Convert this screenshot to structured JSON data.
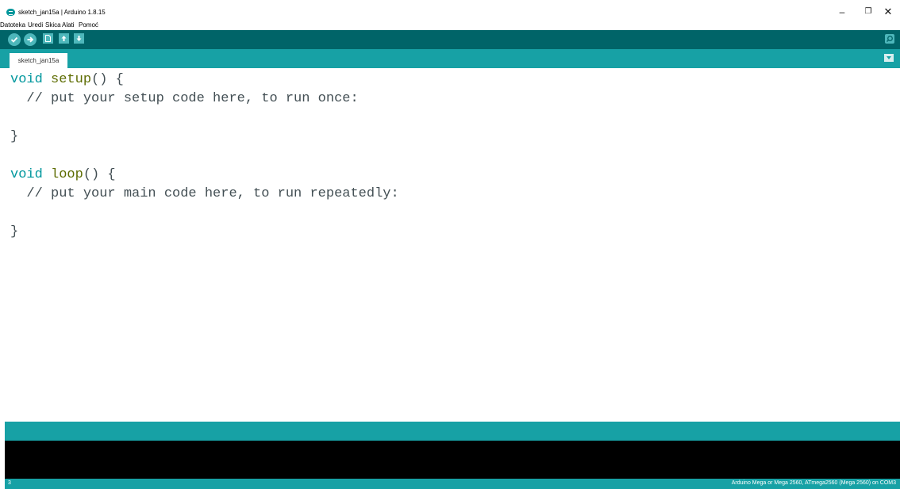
{
  "window": {
    "title": "sketch_jan15a | Arduino 1.8.15",
    "minimize": "–",
    "restore": "❐",
    "close": "✕"
  },
  "menu": [
    "Datoteka",
    "Uredi",
    "Skica",
    "Alati",
    "Pomoć"
  ],
  "toolbar": {
    "icons": [
      "verify-icon",
      "upload-icon",
      "new-icon",
      "open-icon",
      "save-icon",
      "serial-monitor-icon"
    ]
  },
  "tabs": [
    {
      "label": "sketch_jan15a"
    }
  ],
  "editor": {
    "lines": [
      {
        "type": "void",
        "name": "setup",
        "rest": "() {"
      },
      {
        "comment": "  // put your setup code here, to run once:"
      },
      {
        "text": ""
      },
      {
        "text": "}"
      },
      {
        "text": ""
      },
      {
        "type": "void",
        "name": "loop",
        "rest": "() {"
      },
      {
        "comment": "  // put your main code here, to run repeatedly:"
      },
      {
        "text": ""
      },
      {
        "text": "}"
      }
    ]
  },
  "status": {
    "line_number": "3",
    "board": "Arduino Mega or Mega 2560, ATmega2560 (Mega 2560) on COM3"
  },
  "colors": {
    "toolbar": "#006468",
    "tabstrip": "#17a1a5",
    "keyword_type": "#00979d",
    "keyword_func": "#5e6d03",
    "console": "#000000"
  }
}
